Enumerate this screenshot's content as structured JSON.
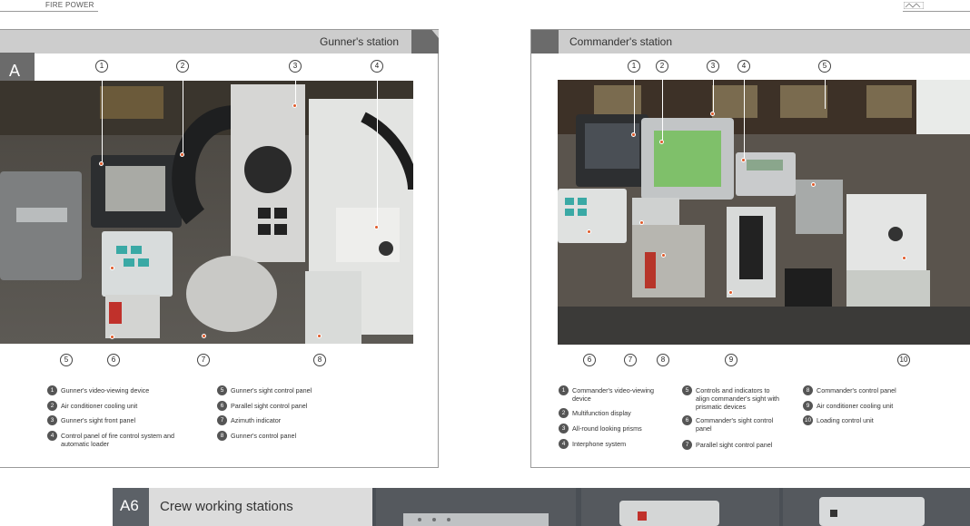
{
  "page": {
    "section_label": "FIRE POWER"
  },
  "gunner": {
    "title": "Gunner's station",
    "badge": "A",
    "callouts": [
      "1",
      "2",
      "3",
      "4",
      "5",
      "6",
      "7",
      "8"
    ],
    "legend": [
      {
        "num": "1",
        "text": "Gunner's video-viewing device"
      },
      {
        "num": "2",
        "text": "Air conditioner cooling unit"
      },
      {
        "num": "3",
        "text": "Gunner's sight front panel"
      },
      {
        "num": "4",
        "text": "Control panel of fire control system and automatic loader"
      },
      {
        "num": "5",
        "text": "Gunner's sight control panel"
      },
      {
        "num": "6",
        "text": "Parallel sight control panel"
      },
      {
        "num": "7",
        "text": "Azimuth indicator"
      },
      {
        "num": "8",
        "text": "Gunner's control panel"
      }
    ]
  },
  "commander": {
    "title": "Commander's station",
    "callouts": [
      "1",
      "2",
      "3",
      "4",
      "5",
      "6",
      "7",
      "8",
      "9",
      "10"
    ],
    "legend": [
      {
        "num": "1",
        "text": "Commander's video-viewing device"
      },
      {
        "num": "2",
        "text": "Multifunction display"
      },
      {
        "num": "3",
        "text": "All-round looking prisms"
      },
      {
        "num": "4",
        "text": "Interphone system"
      },
      {
        "num": "5",
        "text": "Controls and indicators to align commander's sight with prismatic devices"
      },
      {
        "num": "6",
        "text": "Commander's sight control panel"
      },
      {
        "num": "7",
        "text": "Parallel sight control panel"
      },
      {
        "num": "8",
        "text": "Commander's control panel"
      },
      {
        "num": "9",
        "text": "Air conditioner cooling unit"
      },
      {
        "num": "10",
        "text": "Loading control unit"
      }
    ]
  },
  "footer": {
    "tag": "A6",
    "label": "Crew working stations"
  },
  "colors": {
    "header_gray": "#cdcdcd",
    "tab_dark": "#6b6b6b",
    "marker_orange": "#e05a2a",
    "footer_dark": "#4a4f55"
  }
}
